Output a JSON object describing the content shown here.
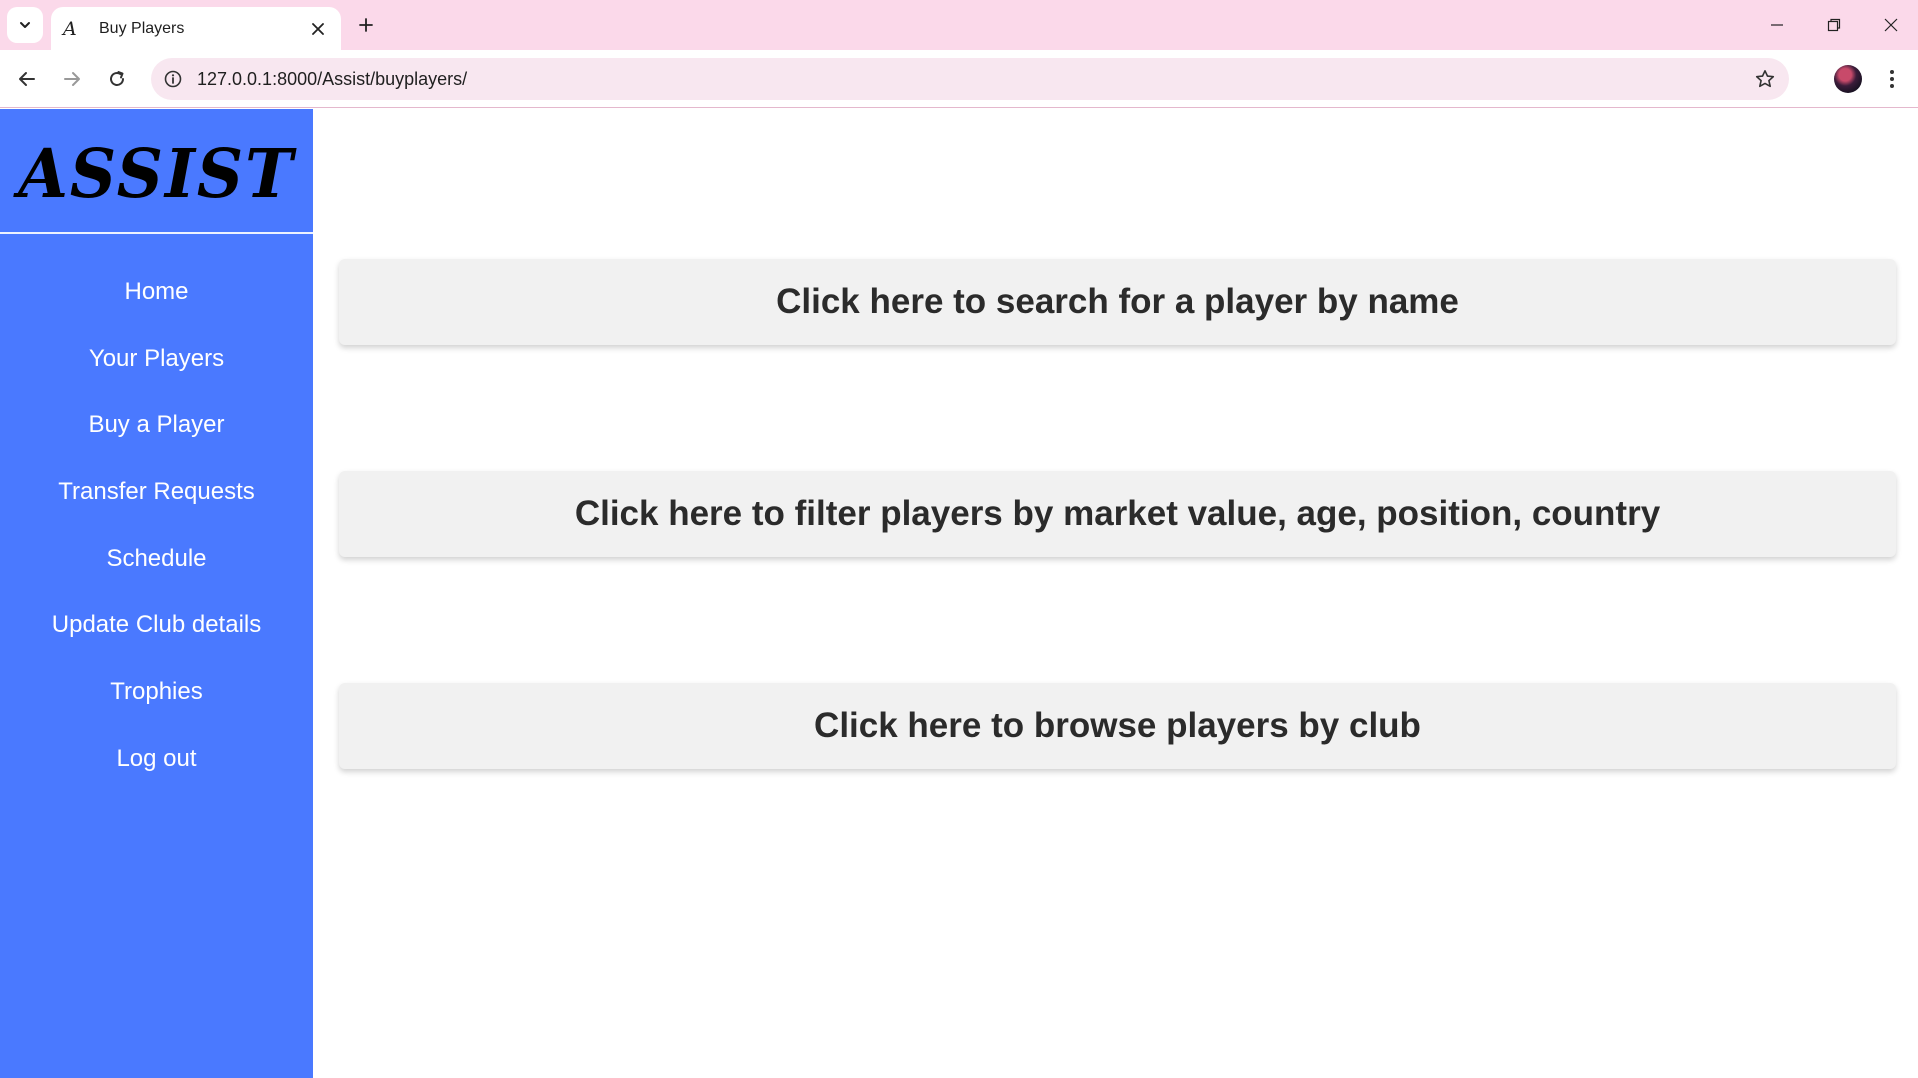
{
  "browser": {
    "tab_title": "Buy Players",
    "tab_favicon": "A",
    "url": "127.0.0.1:8000/Assist/buyplayers/",
    "icons": {
      "tab_search": "chevron-down-icon",
      "tab_close": "close-icon",
      "new_tab": "plus-icon",
      "back": "arrow-left-icon",
      "forward": "arrow-right-icon",
      "reload": "reload-icon",
      "site_info": "info-icon",
      "bookmark": "star-icon",
      "menu": "more-vert-icon"
    }
  },
  "sidebar": {
    "logo": "ASSIST",
    "items": [
      {
        "label": "Home"
      },
      {
        "label": "Your Players"
      },
      {
        "label": "Buy a Player"
      },
      {
        "label": "Transfer Requests"
      },
      {
        "label": "Schedule"
      },
      {
        "label": "Update Club details"
      },
      {
        "label": "Trophies"
      },
      {
        "label": "Log out"
      }
    ]
  },
  "main": {
    "actions": [
      {
        "label": "Click here to search for a player by name"
      },
      {
        "label": "Click here to filter players by market value, age, position, country"
      },
      {
        "label": "Click here to browse players by club"
      }
    ]
  },
  "colors": {
    "sidebar_bg": "#4a79ff",
    "tabbar_bg": "#fbd9ea",
    "card_bg": "#f1f1f1",
    "card_text": "#2b2b2b"
  }
}
